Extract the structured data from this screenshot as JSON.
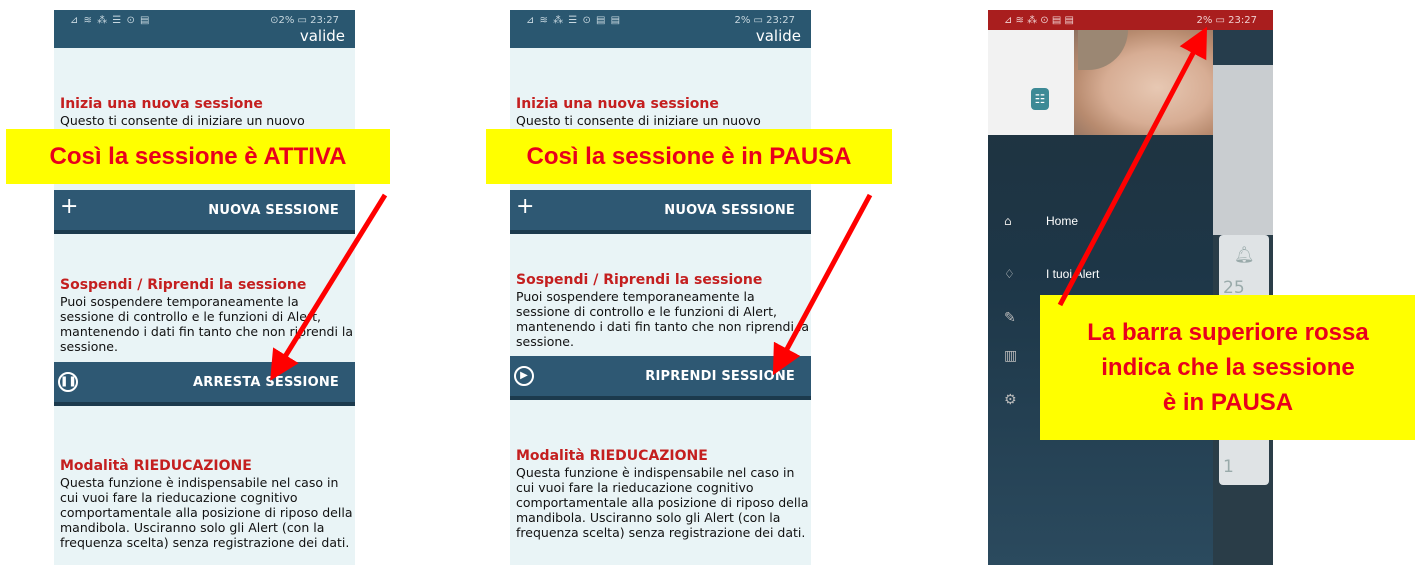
{
  "phone1": {
    "status_left": "⊿ ≋ ⁂ ☰ ⊙ ▤",
    "status_right": "⊙2% ▭ 23:27",
    "top_band_text": "valide",
    "new_session": {
      "title": "Inizia una nuova sessione",
      "body": "Questo ti consente di iniziare un nuovo periodo di",
      "button_label": "NUOVA SESSIONE"
    },
    "pause_section": {
      "title": "Sospendi / Riprendi la sessione",
      "body": "Puoi sospendere temporaneamente la sessione di controllo e le funzioni di Alert, mantenendo i dati fin tanto che non riprendi la sessione.",
      "button_label": "ARRESTA SESSIONE",
      "button_icon": "pause-icon"
    },
    "rieducazione": {
      "title": "Modalità  RIEDUCAZIONE",
      "body": "Questa funzione è indispensabile nel caso in cui vuoi fare la rieducazione cognitivo comportamentale alla posizione di riposo della mandibola. Usciranno solo gli Alert (con la frequenza scelta) senza registrazione dei dati."
    }
  },
  "phone2": {
    "status_left": "⊿ ≋ ⁂ ☰ ⊙ ▤ ▤",
    "status_right": "2% ▭ 23:27",
    "top_band_text": "valide",
    "new_session": {
      "title": "Inizia una nuova sessione",
      "body": "Questo ti consente di iniziare un nuovo periodo di",
      "button_label": "NUOVA SESSIONE"
    },
    "pause_section": {
      "title": "Sospendi / Riprendi la sessione",
      "body": "Puoi sospendere temporaneamente la sessione di controllo e le funzioni di Alert, mantenendo i dati fin tanto che non riprendi la sessione.",
      "button_label": "RIPRENDI SESSIONE",
      "button_icon": "play-icon"
    },
    "rieducazione": {
      "title": "Modalità  RIEDUCAZIONE",
      "body": "Questa funzione è indispensabile nel caso in cui vuoi fare la rieducazione cognitivo comportamentale alla posizione di riposo della mandibola. Usciranno solo gli Alert (con la frequenza scelta) senza registrazione dei dati."
    }
  },
  "phone3": {
    "status_left": "⊿ ≋ ⁂ ⊙ ▤ ▤",
    "status_right": "2% ▭ 23:27",
    "menu": [
      {
        "icon": "home-icon",
        "label": "Home"
      },
      {
        "icon": "bell-icon",
        "label": "I tuoi Alert"
      }
    ],
    "card_numbers": [
      "25",
      "1"
    ]
  },
  "callouts": {
    "active": "Così la sessione è ATTIVA",
    "paused": "Così la sessione è in PAUSA",
    "red_bar_line1": "La barra superiore rossa",
    "red_bar_line2": "indica che la sessione",
    "red_bar_line3": "è in PAUSA"
  },
  "colors": {
    "status_active": "#2a5770",
    "status_paused": "#a91e1e",
    "callout_bg": "#ffff00",
    "callout_text": "#e8001c",
    "arrow": "#ff0000",
    "title_red": "#c41f1f"
  }
}
